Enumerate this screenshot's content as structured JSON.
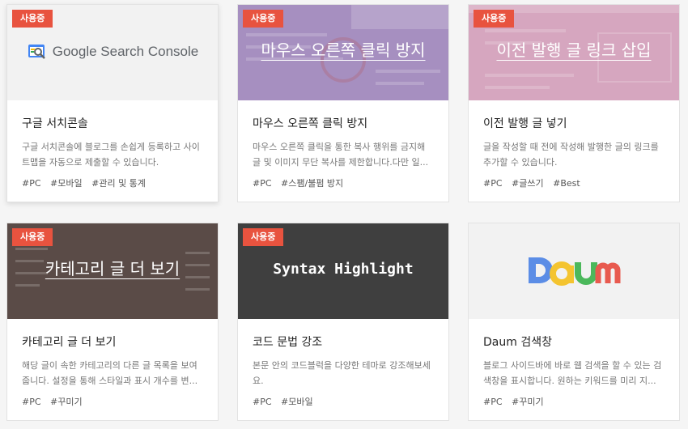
{
  "status_badge": "사용중",
  "cards": [
    {
      "thumb_text": "Google Search Console",
      "title": "구글 서치콘솔",
      "desc": "구글 서치콘솔에 블로그를 손쉽게 등록하고 사이트맵을 자동으로 제출할 수 있습니다.",
      "tags": [
        "#PC",
        "#모바일",
        "#관리 및 통계"
      ],
      "thumb_bg": "#f2f2f2"
    },
    {
      "thumb_text": "마우스 오른쪽 클릭 방지",
      "title": "마우스 오른쪽 클릭 방지",
      "desc": "마우스 오른쪽 클릭을 통한 복사 행위를 금지해 글 및 이미지 무단 복사를 제한합니다.다만 일...",
      "tags": [
        "#PC",
        "#스팸/불펌 방지"
      ],
      "thumb_bg": "#a68fc0"
    },
    {
      "thumb_text": "이전 발행 글 링크 삽입",
      "title": "이전 발행 글 넣기",
      "desc": "글을 작성할 때 전에 작성해 발행한 글의 링크를 추가할 수 있습니다.",
      "tags": [
        "#PC",
        "#글쓰기",
        "#Best"
      ],
      "thumb_bg": "#d6a6bf"
    },
    {
      "thumb_text": "카테고리 글 더 보기",
      "title": "카테고리 글 더 보기",
      "desc": "해당 글이 속한 카테고리의 다른 글 목록을 보여줍니다. 설정을 통해 스타일과 표시 개수를 변...",
      "tags": [
        "#PC",
        "#꾸미기"
      ],
      "thumb_bg": "#5a4b47"
    },
    {
      "thumb_text": "Syntax Highlight",
      "title": "코드 문법 강조",
      "desc": "본문 안의 코드블럭을 다양한 테마로 강조해보세요.",
      "tags": [
        "#PC",
        "#모바일"
      ],
      "thumb_bg": "#3f3f3f"
    },
    {
      "thumb_text": "Daum",
      "title": "Daum 검색창",
      "desc": "블로그 사이드바에 바로 웹 검색을 할 수 있는 검색창을 표시합니다. 원하는 키워드를 미리 지...",
      "tags": [
        "#PC",
        "#꾸미기"
      ],
      "thumb_bg": "#f2f2f2"
    }
  ],
  "colors": {
    "badge": "#e8533f",
    "daum_blue": "#5b8de6",
    "daum_yellow": "#f4c430",
    "daum_green": "#4bb85b",
    "daum_red": "#e85a4f"
  }
}
